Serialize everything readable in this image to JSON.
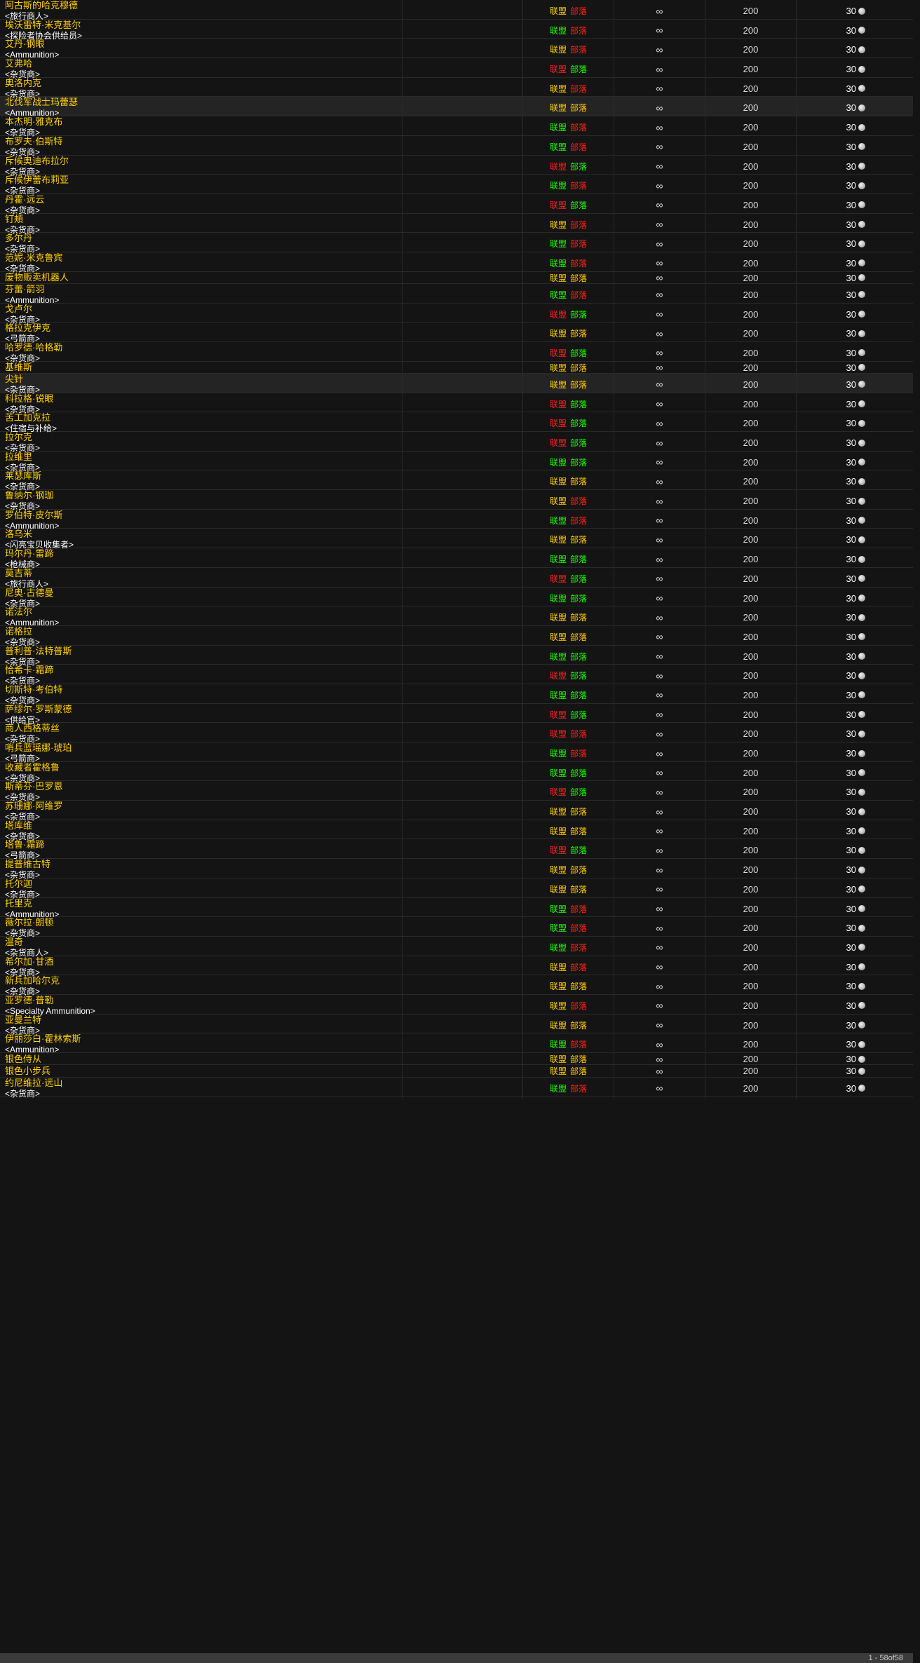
{
  "faction_labels": {
    "alliance": "联盟",
    "horde": "部落"
  },
  "colors": {
    "name": "#ffd100",
    "green": "#1eff00",
    "red": "#ff2020",
    "yellow": "#ffd100",
    "background": "#141414",
    "highlight_row": "#242424"
  },
  "icons": {
    "cost": "silver-coin-icon"
  },
  "rows": [
    {
      "name": "阿古斯的哈克穆德",
      "tag": "<旅行商人>",
      "a": "y",
      "h": "r",
      "count": "∞",
      "stack": "200",
      "cost": "30"
    },
    {
      "name": "埃沃雷特·米克基尔",
      "tag": "<探险者协会供给员>",
      "a": "g",
      "h": "r",
      "count": "∞",
      "stack": "200",
      "cost": "30"
    },
    {
      "name": "艾丹·钢眼",
      "tag": "<Ammunition>",
      "a": "y",
      "h": "r",
      "count": "∞",
      "stack": "200",
      "cost": "30"
    },
    {
      "name": "艾弗哈",
      "tag": "<杂货商>",
      "a": "r",
      "h": "g",
      "count": "∞",
      "stack": "200",
      "cost": "30"
    },
    {
      "name": "奥洛内克",
      "tag": "<杂货商>",
      "a": "y",
      "h": "r",
      "count": "∞",
      "stack": "200",
      "cost": "30"
    },
    {
      "name": "北伐军战士玛蕾瑟",
      "tag": "<Ammunition>",
      "a": "y",
      "h": "y",
      "count": "∞",
      "stack": "200",
      "cost": "30",
      "hl": true
    },
    {
      "name": "本杰明·雅克布",
      "tag": "<杂货商>",
      "a": "g",
      "h": "r",
      "count": "∞",
      "stack": "200",
      "cost": "30"
    },
    {
      "name": "布罗夫·伯斯特",
      "tag": "<杂货商>",
      "a": "g",
      "h": "r",
      "count": "∞",
      "stack": "200",
      "cost": "30"
    },
    {
      "name": "斥候奥迪布拉尔",
      "tag": "<杂货商>",
      "a": "r",
      "h": "g",
      "count": "∞",
      "stack": "200",
      "cost": "30"
    },
    {
      "name": "斥候伊蕾布莉亚",
      "tag": "<杂货商>",
      "a": "g",
      "h": "r",
      "count": "∞",
      "stack": "200",
      "cost": "30"
    },
    {
      "name": "丹霍·远云",
      "tag": "<杂货商>",
      "a": "r",
      "h": "g",
      "count": "∞",
      "stack": "200",
      "cost": "30"
    },
    {
      "name": "钉頰",
      "tag": "<杂货商>",
      "a": "y",
      "h": "r",
      "count": "∞",
      "stack": "200",
      "cost": "30"
    },
    {
      "name": "多尔丹",
      "tag": "<杂货商>",
      "a": "g",
      "h": "r",
      "count": "∞",
      "stack": "200",
      "cost": "30"
    },
    {
      "name": "范妮·米克鲁宾",
      "tag": "<杂货商>",
      "a": "g",
      "h": "r",
      "count": "∞",
      "stack": "200",
      "cost": "30"
    },
    {
      "name": "废物贩卖机器人",
      "tag": "",
      "a": "y",
      "h": "y",
      "count": "∞",
      "stack": "200",
      "cost": "30"
    },
    {
      "name": "芬蕾·箭羽",
      "tag": "<Ammunition>",
      "a": "g",
      "h": "r",
      "count": "∞",
      "stack": "200",
      "cost": "30"
    },
    {
      "name": "戈卢尔",
      "tag": "<杂货商>",
      "a": "r",
      "h": "g",
      "count": "∞",
      "stack": "200",
      "cost": "30"
    },
    {
      "name": "格拉克伊克",
      "tag": "<弓箭商>",
      "a": "y",
      "h": "y",
      "count": "∞",
      "stack": "200",
      "cost": "30"
    },
    {
      "name": "哈罗德·哈格勒",
      "tag": "<杂货商>",
      "a": "r",
      "h": "g",
      "count": "∞",
      "stack": "200",
      "cost": "30"
    },
    {
      "name": "基维斯",
      "tag": "",
      "a": "y",
      "h": "y",
      "count": "∞",
      "stack": "200",
      "cost": "30"
    },
    {
      "name": "尖针",
      "tag": "<杂货商>",
      "a": "y",
      "h": "y",
      "count": "∞",
      "stack": "200",
      "cost": "30",
      "hl": true
    },
    {
      "name": "科拉格·锐眼",
      "tag": "<杂货商>",
      "a": "r",
      "h": "g",
      "count": "∞",
      "stack": "200",
      "cost": "30"
    },
    {
      "name": "苦工加克拉",
      "tag": "<住宿与补给>",
      "a": "r",
      "h": "g",
      "count": "∞",
      "stack": "200",
      "cost": "30"
    },
    {
      "name": "拉尔克",
      "tag": "<杂货商>",
      "a": "r",
      "h": "g",
      "count": "∞",
      "stack": "200",
      "cost": "30"
    },
    {
      "name": "拉维里",
      "tag": "<杂货商>",
      "a": "g",
      "h": "g",
      "count": "∞",
      "stack": "200",
      "cost": "30"
    },
    {
      "name": "莱瑟库斯",
      "tag": "<杂货商>",
      "a": "y",
      "h": "y",
      "count": "∞",
      "stack": "200",
      "cost": "30"
    },
    {
      "name": "鲁纳尔·钢珈",
      "tag": "<杂货商>",
      "a": "y",
      "h": "r",
      "count": "∞",
      "stack": "200",
      "cost": "30"
    },
    {
      "name": "罗伯特·皮尔斯",
      "tag": "<Ammunition>",
      "a": "g",
      "h": "r",
      "count": "∞",
      "stack": "200",
      "cost": "30"
    },
    {
      "name": "洛乌米",
      "tag": "<闪亮宝贝收集者>",
      "a": "y",
      "h": "y",
      "count": "∞",
      "stack": "200",
      "cost": "30"
    },
    {
      "name": "玛尔丹·雷蹄",
      "tag": "<枪械商>",
      "a": "g",
      "h": "g",
      "count": "∞",
      "stack": "200",
      "cost": "30"
    },
    {
      "name": "莫吉蒂",
      "tag": "<旅行商人>",
      "a": "r",
      "h": "g",
      "count": "∞",
      "stack": "200",
      "cost": "30"
    },
    {
      "name": "尼奥·古德曼",
      "tag": "<杂货商>",
      "a": "g",
      "h": "g",
      "count": "∞",
      "stack": "200",
      "cost": "30"
    },
    {
      "name": "诺法尔",
      "tag": "<Ammunition>",
      "a": "y",
      "h": "y",
      "count": "∞",
      "stack": "200",
      "cost": "30"
    },
    {
      "name": "诺格拉",
      "tag": "<杂货商>",
      "a": "y",
      "h": "y",
      "count": "∞",
      "stack": "200",
      "cost": "30"
    },
    {
      "name": "普利普·法特普斯",
      "tag": "<杂货商>",
      "a": "g",
      "h": "g",
      "count": "∞",
      "stack": "200",
      "cost": "30"
    },
    {
      "name": "恰希卡·霜蹄",
      "tag": "<杂货商>",
      "a": "r",
      "h": "g",
      "count": "∞",
      "stack": "200",
      "cost": "30"
    },
    {
      "name": "切斯特·考伯特",
      "tag": "<杂货商>",
      "a": "g",
      "h": "g",
      "count": "∞",
      "stack": "200",
      "cost": "30"
    },
    {
      "name": "萨缪尔·罗斯蒙德",
      "tag": "<供给官>",
      "a": "r",
      "h": "g",
      "count": "∞",
      "stack": "200",
      "cost": "30"
    },
    {
      "name": "商人西格蒂丝",
      "tag": "<杂货商>",
      "a": "r",
      "h": "r",
      "count": "∞",
      "stack": "200",
      "cost": "30"
    },
    {
      "name": "哨兵蓝瑶娜·琥珀",
      "tag": "<弓箭商>",
      "a": "g",
      "h": "r",
      "count": "∞",
      "stack": "200",
      "cost": "30"
    },
    {
      "name": "收藏者霍格鲁",
      "tag": "<杂货商>",
      "a": "g",
      "h": "g",
      "count": "∞",
      "stack": "200",
      "cost": "30"
    },
    {
      "name": "斯蒂芬·巴罗恩",
      "tag": "<杂货商>",
      "a": "r",
      "h": "g",
      "count": "∞",
      "stack": "200",
      "cost": "30"
    },
    {
      "name": "苏珊娜·阿维罗",
      "tag": "<杂货商>",
      "a": "y",
      "h": "y",
      "count": "∞",
      "stack": "200",
      "cost": "30"
    },
    {
      "name": "塔库维",
      "tag": "<杂货商>",
      "a": "y",
      "h": "y",
      "count": "∞",
      "stack": "200",
      "cost": "30"
    },
    {
      "name": "塔鲁·霜蹄",
      "tag": "<弓箭商>",
      "a": "r",
      "h": "g",
      "count": "∞",
      "stack": "200",
      "cost": "30"
    },
    {
      "name": "提普维古特",
      "tag": "<杂货商>",
      "a": "y",
      "h": "y",
      "count": "∞",
      "stack": "200",
      "cost": "30"
    },
    {
      "name": "托尔迦",
      "tag": "<杂货商>",
      "a": "y",
      "h": "y",
      "count": "∞",
      "stack": "200",
      "cost": "30"
    },
    {
      "name": "托里克",
      "tag": "<Ammunition>",
      "a": "g",
      "h": "r",
      "count": "∞",
      "stack": "200",
      "cost": "30"
    },
    {
      "name": "薇尔拉·朗顿",
      "tag": "<杂货商>",
      "a": "g",
      "h": "r",
      "count": "∞",
      "stack": "200",
      "cost": "30"
    },
    {
      "name": "温奇",
      "tag": "<杂货商人>",
      "a": "g",
      "h": "r",
      "count": "∞",
      "stack": "200",
      "cost": "30"
    },
    {
      "name": "希尔加·甘酒",
      "tag": "<杂货商>",
      "a": "y",
      "h": "r",
      "count": "∞",
      "stack": "200",
      "cost": "30"
    },
    {
      "name": "新兵加哈尔克",
      "tag": "<杂货商>",
      "a": "y",
      "h": "y",
      "count": "∞",
      "stack": "200",
      "cost": "30"
    },
    {
      "name": "亚罗德·普勒",
      "tag": "<Specialty Ammunition>",
      "a": "y",
      "h": "r",
      "count": "∞",
      "stack": "200",
      "cost": "30"
    },
    {
      "name": "亚曼兰特",
      "tag": "<杂货商>",
      "a": "y",
      "h": "y",
      "count": "∞",
      "stack": "200",
      "cost": "30"
    },
    {
      "name": "伊丽莎白·霍林索斯",
      "tag": "<Ammunition>",
      "a": "g",
      "h": "r",
      "count": "∞",
      "stack": "200",
      "cost": "30"
    },
    {
      "name": "银色侍从",
      "tag": "",
      "a": "y",
      "h": "y",
      "count": "∞",
      "stack": "200",
      "cost": "30"
    },
    {
      "name": "银色小步兵",
      "tag": "",
      "a": "y",
      "h": "y",
      "count": "∞",
      "stack": "200",
      "cost": "30"
    },
    {
      "name": "约尼维拉·远山",
      "tag": "<杂货商>",
      "a": "g",
      "h": "r",
      "count": "∞",
      "stack": "200",
      "cost": "30"
    }
  ],
  "pager": {
    "text": "1 - 58of58"
  }
}
